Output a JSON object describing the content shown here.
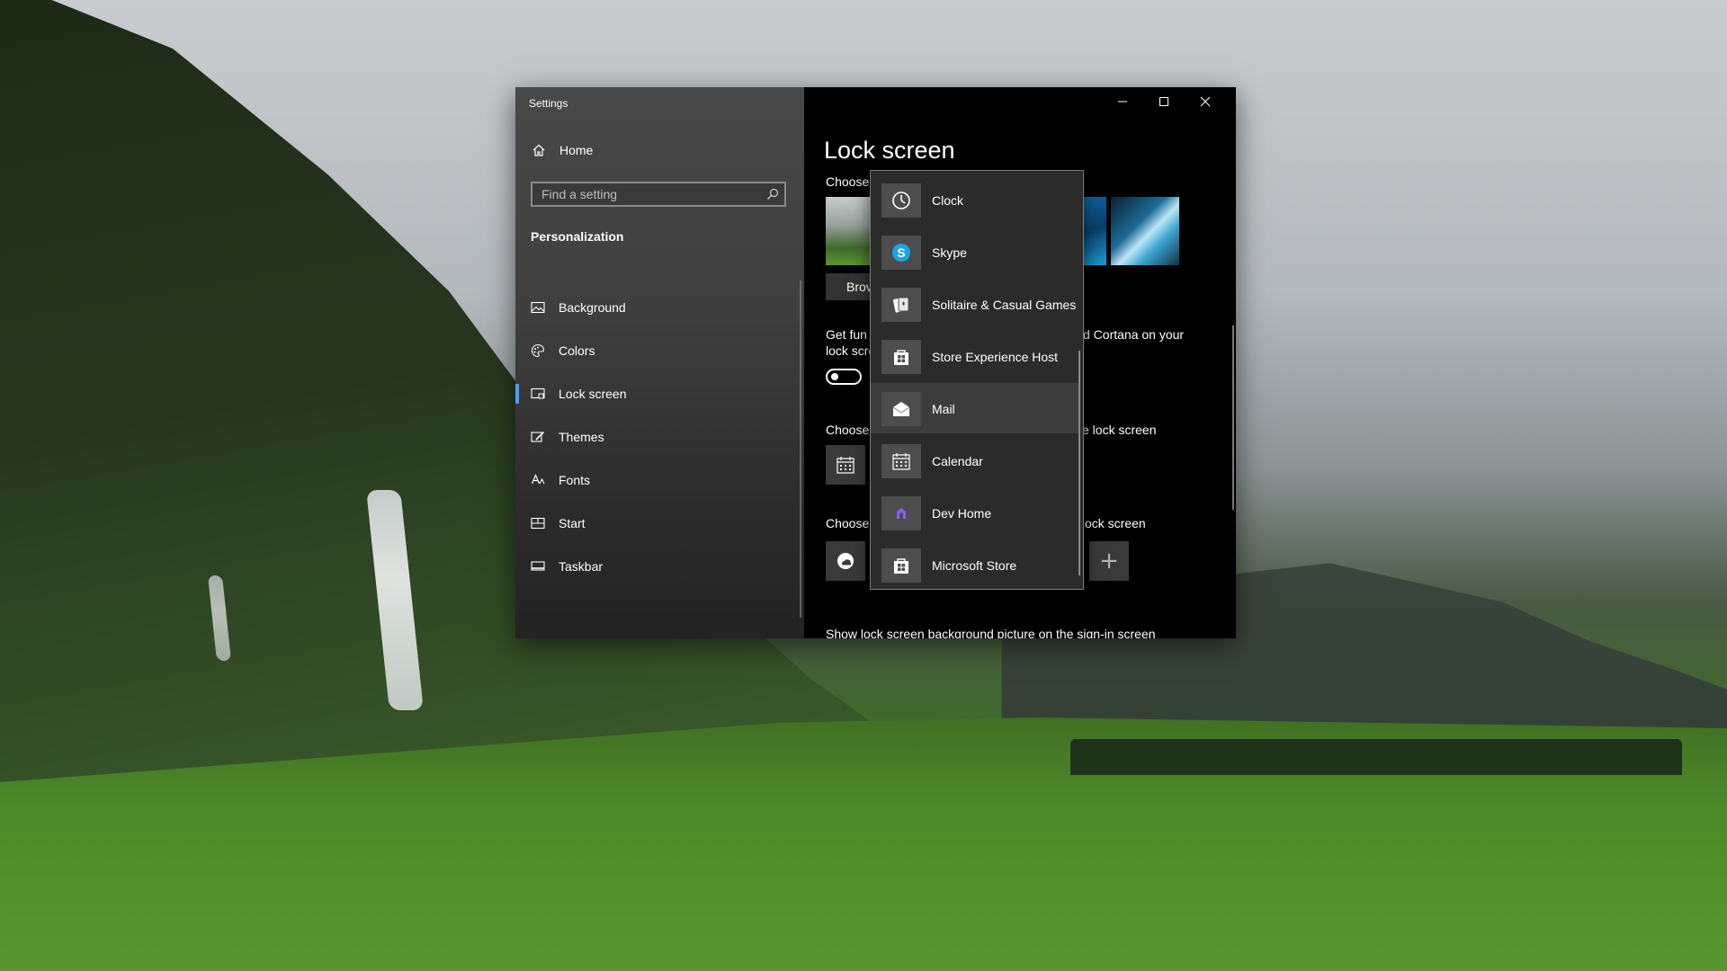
{
  "window": {
    "title": "Settings",
    "controls": {
      "minimize": "minimize-icon",
      "maximize": "maximize-icon",
      "close": "close-icon"
    }
  },
  "sidebar": {
    "home_label": "Home",
    "search_placeholder": "Find a setting",
    "section_title": "Personalization",
    "items": [
      {
        "label": "Background",
        "icon": "picture-icon"
      },
      {
        "label": "Colors",
        "icon": "palette-icon"
      },
      {
        "label": "Lock screen",
        "icon": "lock-screen-icon",
        "active": true
      },
      {
        "label": "Themes",
        "icon": "brush-icon"
      },
      {
        "label": "Fonts",
        "icon": "font-icon"
      },
      {
        "label": "Start",
        "icon": "start-icon"
      },
      {
        "label": "Taskbar",
        "icon": "taskbar-icon"
      }
    ]
  },
  "main": {
    "page_title": "Lock screen",
    "choose_picture_label": "Choose",
    "browse_label": "Brov",
    "fun_facts_line1_left": "Get fun",
    "fun_facts_line1_right": "d Cortana on your",
    "fun_facts_line2": "lock scre",
    "detailed_status_left": "Choose",
    "detailed_status_right": "e lock screen",
    "quick_status_left": "Choose",
    "quick_status_right": "ock screen",
    "add_label": "+",
    "signin_line": "Show lock screen background picture on the sign-in screen"
  },
  "flyout": {
    "items": [
      {
        "label": "Clock",
        "icon": "clock-icon"
      },
      {
        "label": "Skype",
        "icon": "skype-icon"
      },
      {
        "label": "Solitaire & Casual Games",
        "icon": "cards-icon"
      },
      {
        "label": "Store Experience Host",
        "icon": "store-icon"
      },
      {
        "label": "Mail",
        "icon": "mail-icon",
        "hovered": true
      },
      {
        "label": "Calendar",
        "icon": "calendar-icon"
      },
      {
        "label": "Dev Home",
        "icon": "dev-home-icon"
      },
      {
        "label": "Microsoft Store",
        "icon": "store-icon"
      }
    ]
  },
  "colors": {
    "accent": "#4c9bff",
    "content_bg": "#000000",
    "flyout_bg": "#2b2b2b",
    "skype": "#1da1e8",
    "dev_home": "#8b5cf6"
  }
}
